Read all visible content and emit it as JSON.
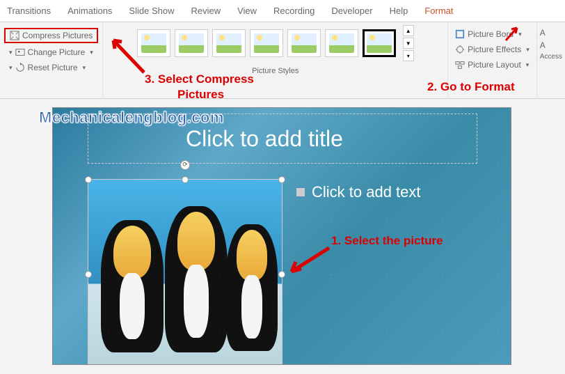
{
  "tabs": {
    "transitions": "Transitions",
    "animations": "Animations",
    "slideshow": "Slide Show",
    "review": "Review",
    "view": "View",
    "recording": "Recording",
    "developer": "Developer",
    "help": "Help",
    "format": "Format"
  },
  "adjust": {
    "compress": "Compress Pictures",
    "change": "Change Picture",
    "reset": "Reset Picture"
  },
  "styles": {
    "label": "Picture Styles"
  },
  "format_group": {
    "border": "Picture Bord",
    "effects": "Picture Effects",
    "layout": "Picture Layout"
  },
  "right": {
    "item1": "A",
    "item2": "A",
    "access": "Access"
  },
  "slide": {
    "title_placeholder": "Click to add title",
    "text_placeholder": "Click to add text"
  },
  "watermark": "Mechanicalengblog.com",
  "annotations": {
    "step1": "1.  Select the picture",
    "step2": "2. Go to Format",
    "step3a": "3. Select Compress",
    "step3b": "Pictures"
  }
}
